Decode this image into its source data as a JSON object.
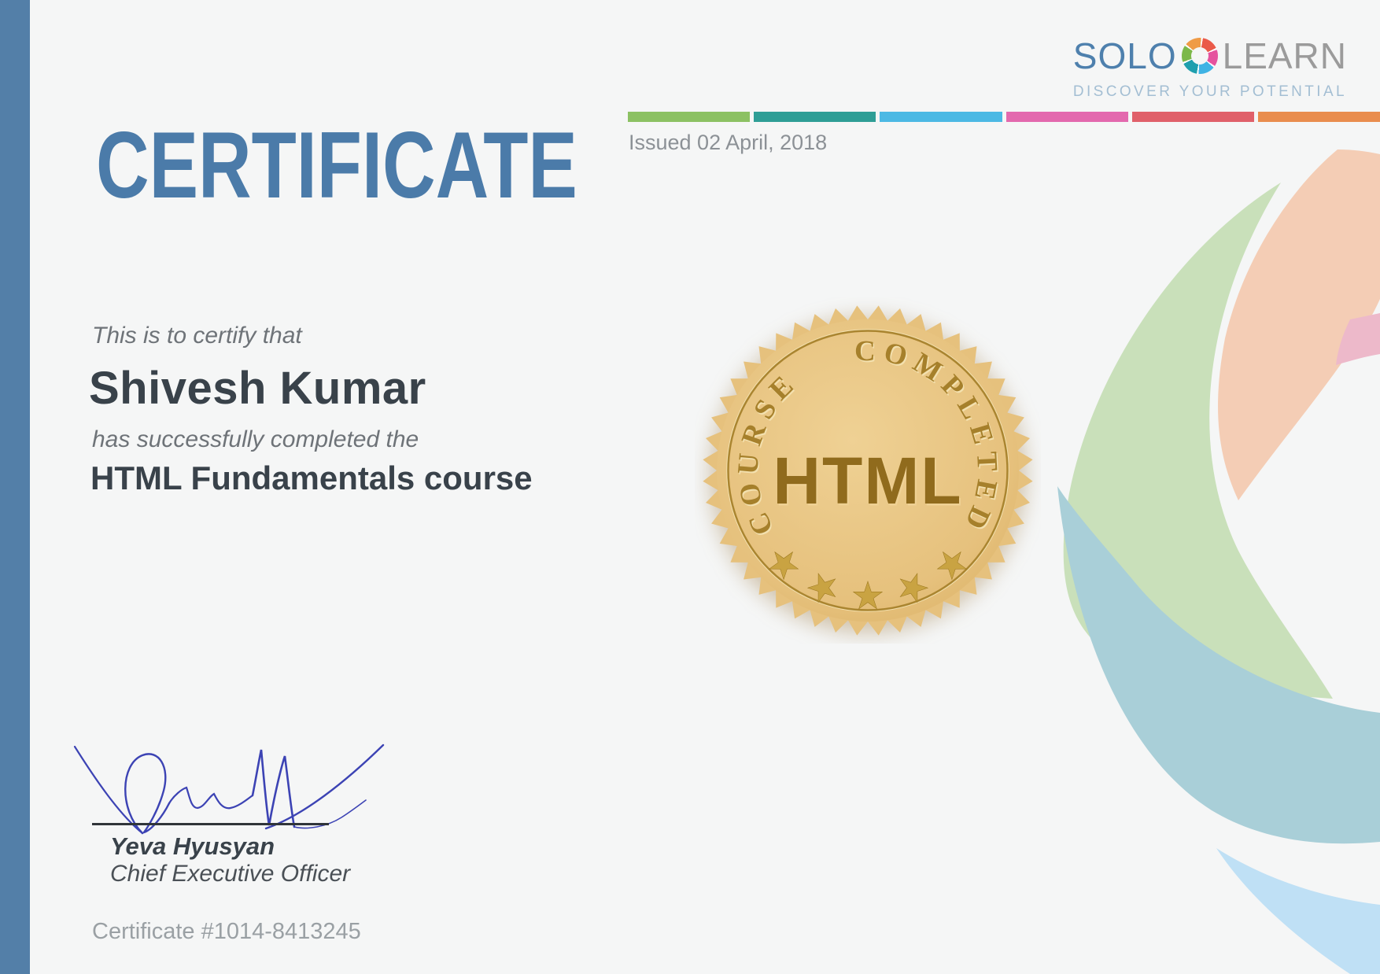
{
  "header": {
    "title": "CERTIFICATE",
    "issued_label": "Issued 02 April, 2018",
    "accent_bar_segments": [
      "#8cc163",
      "#2f9e96",
      "#4cb9e4",
      "#e369ae",
      "#e0606a",
      "#e98d4e"
    ]
  },
  "brand": {
    "name_primary": "SOLO",
    "name_secondary": "LEARN",
    "tagline": "DISCOVER YOUR POTENTIAL"
  },
  "body": {
    "certify_line": "This is to certify that",
    "recipient_name": "Shivesh Kumar",
    "completion_line": "has successfully completed the",
    "course_name": "HTML Fundamentals course"
  },
  "seal": {
    "arc_text": "COURSE COMPLETED",
    "center_text": "HTML",
    "star_glyph": "★",
    "star_count": 5
  },
  "signature": {
    "signer_name": "Yeva Hyusyan",
    "signer_title": "Chief Executive Officer"
  },
  "footer": {
    "certificate_number": "Certificate #1014-8413245"
  },
  "colors": {
    "bg": "#f5f6f6",
    "bar-blue": "#537fa8",
    "title-blue": "#4b7ba9",
    "text-dark": "#39424a",
    "text-gray": "#6e7378",
    "muted-gray": "#9aa0a4",
    "issued-gray": "#8c9196",
    "logo-blue": "#4e80ad",
    "logo-gray": "#9b9b9b",
    "tagline-blue": "#a3bed3",
    "seal-gold": "#e6c17d",
    "seal-gold-light": "#efd194",
    "seal-ring": "#aa8530",
    "seal-engrave": "#a6802b",
    "seal-engrave-light": "#f3e0ae",
    "seal-html": "#906b1d",
    "seal-star": "#c9a342",
    "seal-star-dark": "#96731a",
    "sig-ink": "#3c43b4",
    "sig-line": "#303539",
    "deco-green": "#c9e0ba",
    "deco-peach": "#f4cdb5",
    "deco-pink": "#edb9ca",
    "deco-teal": "#a9cfd8",
    "deco-sky": "#bfe0f5",
    "ap-orange": "#ef9b46",
    "ap-red": "#ea5a49",
    "ap-pink": "#e5539e",
    "ap-blue": "#3fb3e4",
    "ap-teal": "#1f9fae",
    "ap-green": "#7cb849"
  }
}
